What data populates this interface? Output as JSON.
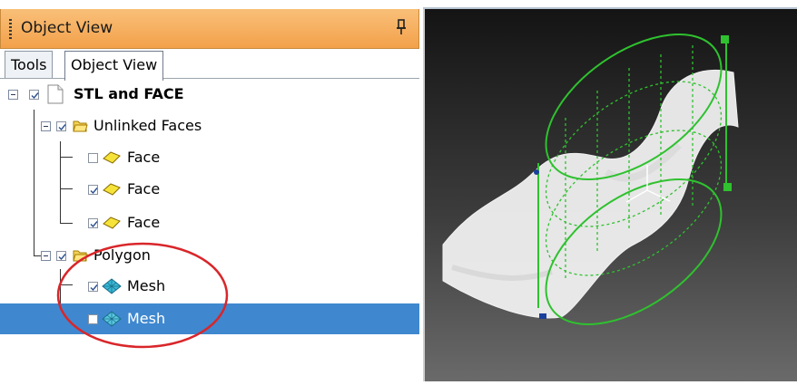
{
  "panel": {
    "title": "Object View",
    "tabs": [
      {
        "label": "Tools",
        "active": false
      },
      {
        "label": "Object View",
        "active": true
      }
    ]
  },
  "tree": {
    "root": {
      "label": "STL and FACE",
      "checked": true,
      "icon": "document-icon"
    },
    "groups": [
      {
        "label": "Unlinked Faces",
        "checked": true,
        "icon": "folder-open-icon",
        "items": [
          {
            "label": "Face",
            "checked": false,
            "icon": "face-icon"
          },
          {
            "label": "Face",
            "checked": true,
            "icon": "face-icon"
          },
          {
            "label": "Face",
            "checked": true,
            "icon": "face-icon"
          }
        ]
      },
      {
        "label": "Polygon",
        "checked": true,
        "icon": "folder-open-icon",
        "items": [
          {
            "label": "Mesh",
            "checked": true,
            "icon": "mesh-icon",
            "selected": false
          },
          {
            "label": "Mesh",
            "checked": false,
            "icon": "mesh-icon",
            "selected": true
          }
        ]
      }
    ]
  },
  "viewport": {
    "description_icons": [
      "mesh-surface",
      "cylinder-wireframe",
      "axis-gizmo"
    ],
    "colors": {
      "wireframe": "#2fc12f",
      "mesh": "#ffffff",
      "highlight": "#d9262a",
      "selection": "#3f88cf"
    }
  }
}
